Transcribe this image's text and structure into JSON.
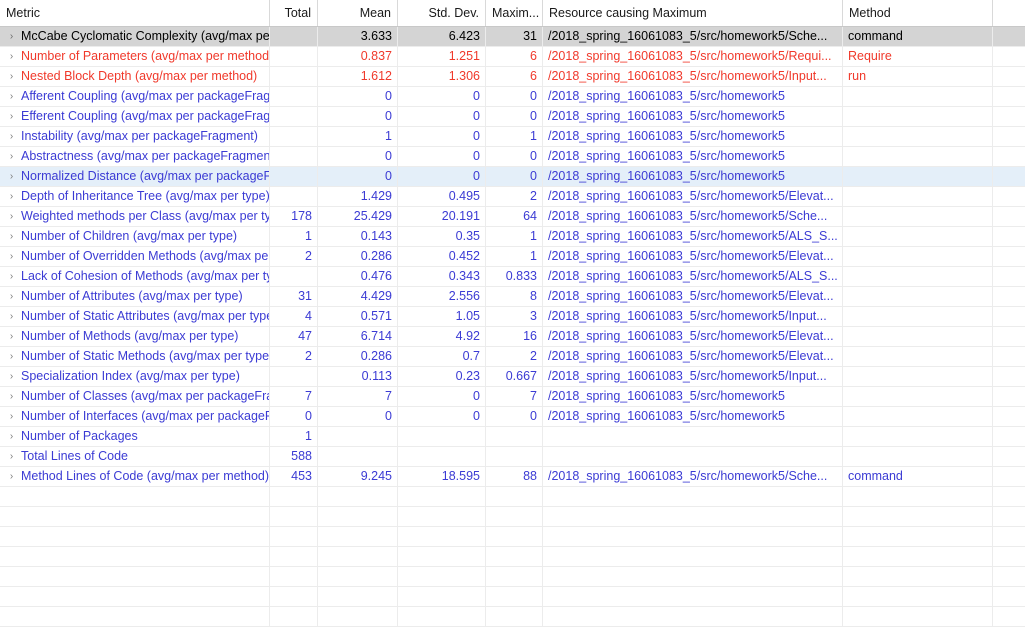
{
  "table": {
    "columns": [
      {
        "key": "metric",
        "label": "Metric",
        "align": "left"
      },
      {
        "key": "total",
        "label": "Total",
        "align": "right"
      },
      {
        "key": "mean",
        "label": "Mean",
        "align": "right"
      },
      {
        "key": "stddev",
        "label": "Std. Dev.",
        "align": "right"
      },
      {
        "key": "max",
        "label": "Maxim...",
        "align": "right"
      },
      {
        "key": "resource",
        "label": "Resource causing Maximum",
        "align": "left"
      },
      {
        "key": "method",
        "label": "Method",
        "align": "left"
      }
    ],
    "expand_icon": "›",
    "colors": {
      "normal": "#3b3bd4",
      "warning": "#f0392b",
      "selected_text": "#000000",
      "selected_row_bg": "#d4d4d4",
      "hover_row_bg": "#e4eff9",
      "grid_line": "#ececec"
    },
    "rows": [
      {
        "metric": "McCabe Cyclomatic Complexity (avg/max per method)",
        "total": "",
        "mean": "3.633",
        "stddev": "6.423",
        "max": "31",
        "resource": "/2018_spring_16061083_5/src/homework5/Sche...",
        "method": "command",
        "severity": "selected",
        "state": "selected"
      },
      {
        "metric": "Number of Parameters (avg/max per method)",
        "total": "",
        "mean": "0.837",
        "stddev": "1.251",
        "max": "6",
        "resource": "/2018_spring_16061083_5/src/homework5/Requi...",
        "method": "Require",
        "severity": "warning",
        "state": "normal"
      },
      {
        "metric": "Nested Block Depth (avg/max per method)",
        "total": "",
        "mean": "1.612",
        "stddev": "1.306",
        "max": "6",
        "resource": "/2018_spring_16061083_5/src/homework5/Input...",
        "method": "run",
        "severity": "warning",
        "state": "normal"
      },
      {
        "metric": "Afferent Coupling (avg/max per packageFragment)",
        "total": "",
        "mean": "0",
        "stddev": "0",
        "max": "0",
        "resource": "/2018_spring_16061083_5/src/homework5",
        "method": "",
        "severity": "normal",
        "state": "normal"
      },
      {
        "metric": "Efferent Coupling (avg/max per packageFragment)",
        "total": "",
        "mean": "0",
        "stddev": "0",
        "max": "0",
        "resource": "/2018_spring_16061083_5/src/homework5",
        "method": "",
        "severity": "normal",
        "state": "normal"
      },
      {
        "metric": "Instability (avg/max per packageFragment)",
        "total": "",
        "mean": "1",
        "stddev": "0",
        "max": "1",
        "resource": "/2018_spring_16061083_5/src/homework5",
        "method": "",
        "severity": "normal",
        "state": "normal"
      },
      {
        "metric": "Abstractness (avg/max per packageFragment)",
        "total": "",
        "mean": "0",
        "stddev": "0",
        "max": "0",
        "resource": "/2018_spring_16061083_5/src/homework5",
        "method": "",
        "severity": "normal",
        "state": "normal"
      },
      {
        "metric": "Normalized Distance (avg/max per packageFragment)",
        "total": "",
        "mean": "0",
        "stddev": "0",
        "max": "0",
        "resource": "/2018_spring_16061083_5/src/homework5",
        "method": "",
        "severity": "normal",
        "state": "hover"
      },
      {
        "metric": "Depth of Inheritance Tree (avg/max per type)",
        "total": "",
        "mean": "1.429",
        "stddev": "0.495",
        "max": "2",
        "resource": "/2018_spring_16061083_5/src/homework5/Elevat...",
        "method": "",
        "severity": "normal",
        "state": "normal"
      },
      {
        "metric": "Weighted methods per Class (avg/max per type)",
        "total": "178",
        "mean": "25.429",
        "stddev": "20.191",
        "max": "64",
        "resource": "/2018_spring_16061083_5/src/homework5/Sche...",
        "method": "",
        "severity": "normal",
        "state": "normal"
      },
      {
        "metric": "Number of Children (avg/max per type)",
        "total": "1",
        "mean": "0.143",
        "stddev": "0.35",
        "max": "1",
        "resource": "/2018_spring_16061083_5/src/homework5/ALS_S...",
        "method": "",
        "severity": "normal",
        "state": "normal"
      },
      {
        "metric": "Number of Overridden Methods (avg/max per type)",
        "total": "2",
        "mean": "0.286",
        "stddev": "0.452",
        "max": "1",
        "resource": "/2018_spring_16061083_5/src/homework5/Elevat...",
        "method": "",
        "severity": "normal",
        "state": "normal"
      },
      {
        "metric": "Lack of Cohesion of Methods (avg/max per type)",
        "total": "",
        "mean": "0.476",
        "stddev": "0.343",
        "max": "0.833",
        "resource": "/2018_spring_16061083_5/src/homework5/ALS_S...",
        "method": "",
        "severity": "normal",
        "state": "normal"
      },
      {
        "metric": "Number of Attributes (avg/max per type)",
        "total": "31",
        "mean": "4.429",
        "stddev": "2.556",
        "max": "8",
        "resource": "/2018_spring_16061083_5/src/homework5/Elevat...",
        "method": "",
        "severity": "normal",
        "state": "normal"
      },
      {
        "metric": "Number of Static Attributes (avg/max per type)",
        "total": "4",
        "mean": "0.571",
        "stddev": "1.05",
        "max": "3",
        "resource": "/2018_spring_16061083_5/src/homework5/Input...",
        "method": "",
        "severity": "normal",
        "state": "normal"
      },
      {
        "metric": "Number of Methods (avg/max per type)",
        "total": "47",
        "mean": "6.714",
        "stddev": "4.92",
        "max": "16",
        "resource": "/2018_spring_16061083_5/src/homework5/Elevat...",
        "method": "",
        "severity": "normal",
        "state": "normal"
      },
      {
        "metric": "Number of Static Methods (avg/max per type)",
        "total": "2",
        "mean": "0.286",
        "stddev": "0.7",
        "max": "2",
        "resource": "/2018_spring_16061083_5/src/homework5/Elevat...",
        "method": "",
        "severity": "normal",
        "state": "normal"
      },
      {
        "metric": "Specialization Index (avg/max per type)",
        "total": "",
        "mean": "0.113",
        "stddev": "0.23",
        "max": "0.667",
        "resource": "/2018_spring_16061083_5/src/homework5/Input...",
        "method": "",
        "severity": "normal",
        "state": "normal"
      },
      {
        "metric": "Number of Classes (avg/max per packageFragment)",
        "total": "7",
        "mean": "7",
        "stddev": "0",
        "max": "7",
        "resource": "/2018_spring_16061083_5/src/homework5",
        "method": "",
        "severity": "normal",
        "state": "normal"
      },
      {
        "metric": "Number of Interfaces (avg/max per packageFragment)",
        "total": "0",
        "mean": "0",
        "stddev": "0",
        "max": "0",
        "resource": "/2018_spring_16061083_5/src/homework5",
        "method": "",
        "severity": "normal",
        "state": "normal"
      },
      {
        "metric": "Number of Packages",
        "total": "1",
        "mean": "",
        "stddev": "",
        "max": "",
        "resource": "",
        "method": "",
        "severity": "normal",
        "state": "normal"
      },
      {
        "metric": "Total Lines of Code",
        "total": "588",
        "mean": "",
        "stddev": "",
        "max": "",
        "resource": "",
        "method": "",
        "severity": "normal",
        "state": "normal"
      },
      {
        "metric": "Method Lines of Code (avg/max per method)",
        "total": "453",
        "mean": "9.245",
        "stddev": "18.595",
        "max": "88",
        "resource": "/2018_spring_16061083_5/src/homework5/Sche...",
        "method": "command",
        "severity": "normal",
        "state": "normal"
      }
    ],
    "empty_row_count": 7
  }
}
